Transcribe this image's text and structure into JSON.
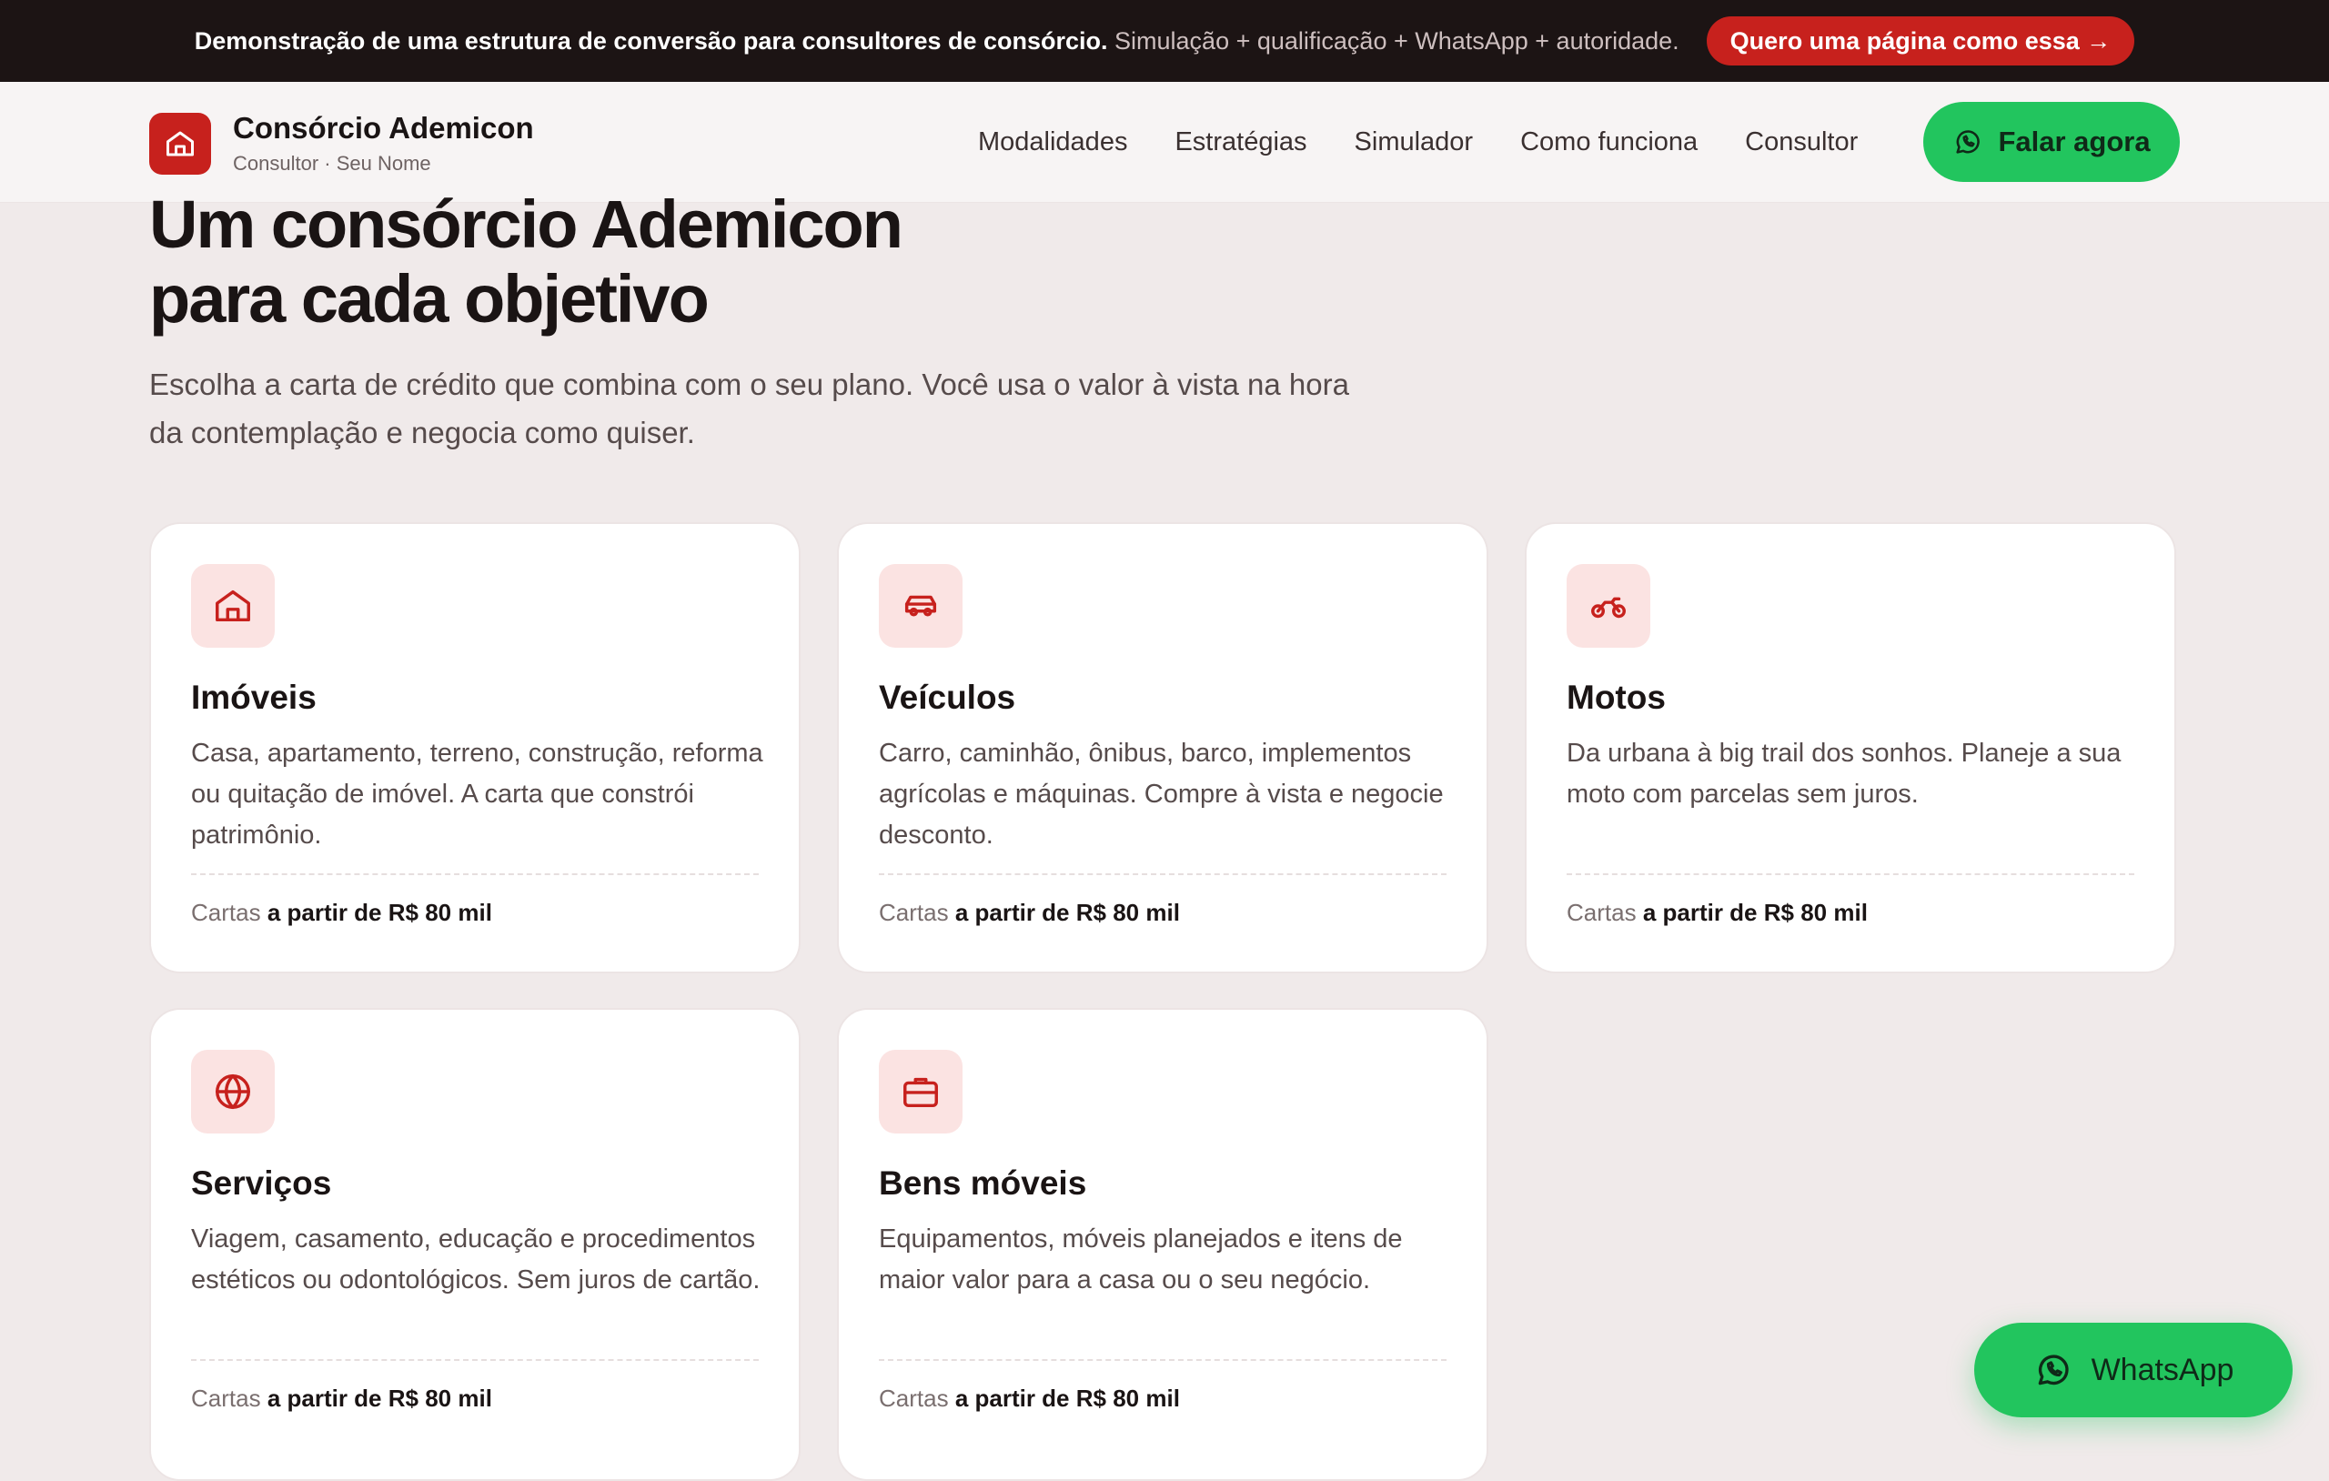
{
  "topbar": {
    "message_bold": "Demonstração de uma estrutura de conversão para consultores de consórcio.",
    "message_rest": "Simulação + qualificação + WhatsApp + autoridade.",
    "cta_label": "Quero uma página como essa →"
  },
  "header": {
    "brand_name": "Consórcio Ademicon",
    "brand_sub": "Consultor · Seu Nome",
    "nav": [
      "Modalidades",
      "Estratégias",
      "Simulador",
      "Como funciona",
      "Consultor"
    ],
    "talk_button": "Falar agora"
  },
  "hero": {
    "title_line1": "Um consórcio Ademicon",
    "title_line2": "para cada objetivo",
    "subtitle": "Escolha a carta de crédito que combina com o seu plano. Você usa o valor à vista na hora da contemplação e negocia como quiser."
  },
  "cards": [
    {
      "icon": "house-icon",
      "title": "Imóveis",
      "desc": "Casa, apartamento, terreno, construção, reforma ou quitação de imóvel. A carta que constrói patrimônio.",
      "foot_prefix": "Cartas",
      "foot_value": "a partir de R$ 80 mil"
    },
    {
      "icon": "car-icon",
      "title": "Veículos",
      "desc": "Carro, caminhão, ônibus, barco, implementos agrícolas e máquinas. Compre à vista e negocie desconto.",
      "foot_prefix": "Cartas",
      "foot_value": "a partir de R$ 80 mil"
    },
    {
      "icon": "motorcycle-icon",
      "title": "Motos",
      "desc": "Da urbana à big trail dos sonhos. Planeje a sua moto com parcelas sem juros.",
      "foot_prefix": "Cartas",
      "foot_value": "a partir de R$ 80 mil"
    },
    {
      "icon": "globe-icon",
      "title": "Serviços",
      "desc": "Viagem, casamento, educação e procedimentos estéticos ou odontológicos. Sem juros de cartão.",
      "foot_prefix": "Cartas",
      "foot_value": "a partir de R$ 80 mil"
    },
    {
      "icon": "briefcase-icon",
      "title": "Bens móveis",
      "desc": "Equipamentos, móveis planejados e itens de maior valor para a casa ou o seu negócio.",
      "foot_prefix": "Cartas",
      "foot_value": "a partir de R$ 80 mil"
    }
  ],
  "whatsapp_float": {
    "label": "WhatsApp"
  },
  "colors": {
    "brand_red": "#c7211d",
    "whatsapp_green": "#22c55e",
    "topbar_bg": "#1c1414",
    "page_bg": "#f0eaea",
    "icon_tile_bg": "#fbe3e2"
  }
}
